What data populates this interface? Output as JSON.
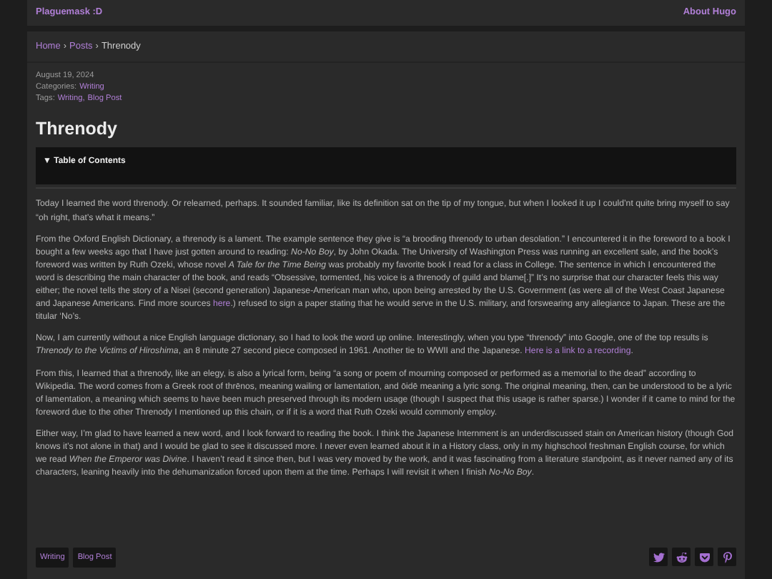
{
  "header": {
    "site_title": "Plaguemask :D",
    "nav_link": "About Hugo"
  },
  "breadcrumb": [
    {
      "label": "Home",
      "kind": "link"
    },
    {
      "label": "›",
      "kind": "separator"
    },
    {
      "label": "Posts",
      "kind": "link"
    },
    {
      "label": "›",
      "kind": "separator"
    },
    {
      "label": "Threnody",
      "kind": "current"
    }
  ],
  "meta": {
    "date": "August 19, 2024",
    "categories_label": "Categories:",
    "categories": [
      "Writing"
    ],
    "tags_label": "Tags:",
    "tags_separator": ",",
    "tags": [
      "Writing",
      "Blog Post"
    ]
  },
  "title": "Threnody",
  "toc": {
    "label": "▼ Table of Contents"
  },
  "paragraphs": [
    [
      {
        "kind": "text",
        "text": "Today I learned the word threnody. Or relearned, perhaps. It sounded familiar, like its definition sat on the tip of my tongue, but when I looked it up I could’nt quite bring myself to say “oh right, that’s what it means.”"
      }
    ],
    [
      {
        "kind": "text",
        "text": "From the Oxford English Dictionary, a threnody is a lament. The example sentence they give is “a brooding threnody to urban desolation.” I encountered it in the foreword to a book I bought a few weeks ago that I have just gotten around to reading: *No-No Boy*, by John Okada. The University of Washington Press was running an excellent sale, and the book’s foreword was written by Ruth Ozeki, whose novel *A Tale for the Time Being* was probably my favorite book I read for a class in College. The sentence in which I encountered the word is describing the main character of the book, and reads “Obsessive, tormented, his voice is a threnody of guild and blame[.]” It’s no surprise that our character feels this way either; the novel tells the story of a Nisei (second generation) Japanese-American man who, upon being arrested by the U.S. Government (as were all of the West Coast Japanese and Japanese Americans. Find more sources "
      },
      {
        "kind": "link",
        "text": "here"
      },
      {
        "kind": "text",
        "text": ".) refused to sign a paper stating that he would serve in the U.S. military, and forswearing any allegiance to Japan. These are the titular ‘No’s."
      }
    ],
    [
      {
        "kind": "text",
        "text": "Now, I am currently without a nice English language dictionary, so I had to look the word up online. Interestingly, when you type “threnody” into Google, one of the top results is *Threnody to the Victims of Hiroshima*, an 8 minute 27 second piece composed in 1961. Another tie to WWII and the Japanese. "
      },
      {
        "kind": "link",
        "text": "Here is a link to a recording"
      },
      {
        "kind": "text",
        "text": "."
      }
    ],
    [
      {
        "kind": "text",
        "text": "From this, I learned that a threnody, like an elegy, is also a lyrical form, being “a song or poem of mourning composed or performed as a memorial to the dead” according to Wikipedia. The word comes from a Greek root of thrēnos, meaning wailing or lamentation, and ōidē meaning a lyric song. The original meaning, then, can be understood to be a lyric of lamentation, a meaning which seems to have been much preserved through its modern usage (though I suspect that this usage is rather sparse.) I wonder if it came to mind for the foreword due to the other Threnody I mentioned up this chain, or if it is a word that Ruth Ozeki would commonly employ."
      }
    ],
    [
      {
        "kind": "text",
        "text": "Either way, I’m glad to have learned a new word, and I look forward to reading the book. I think the Japanese Internment is an underdiscussed stain on American history (though God knows it’s not alone in that) and I would be glad to see it discussed more. I never even learned about it in a History class, only in my highschool freshman English course, for which we read *When the Emperor was Divine*. I haven’t read it since then, but I was very moved by the work, and it was fascinating from a literature standpoint, as it never named any of its characters, leaning heavily into the dehumanization forced upon them at the time. Perhaps I will revisit it when I finish *No-No Boy*."
      }
    ]
  ],
  "footer_tags": [
    "Writing",
    "Blog Post"
  ],
  "share_buttons": [
    {
      "kind": "twitter"
    },
    {
      "kind": "reddit"
    },
    {
      "kind": "pocket"
    },
    {
      "kind": "pinterest"
    }
  ]
}
